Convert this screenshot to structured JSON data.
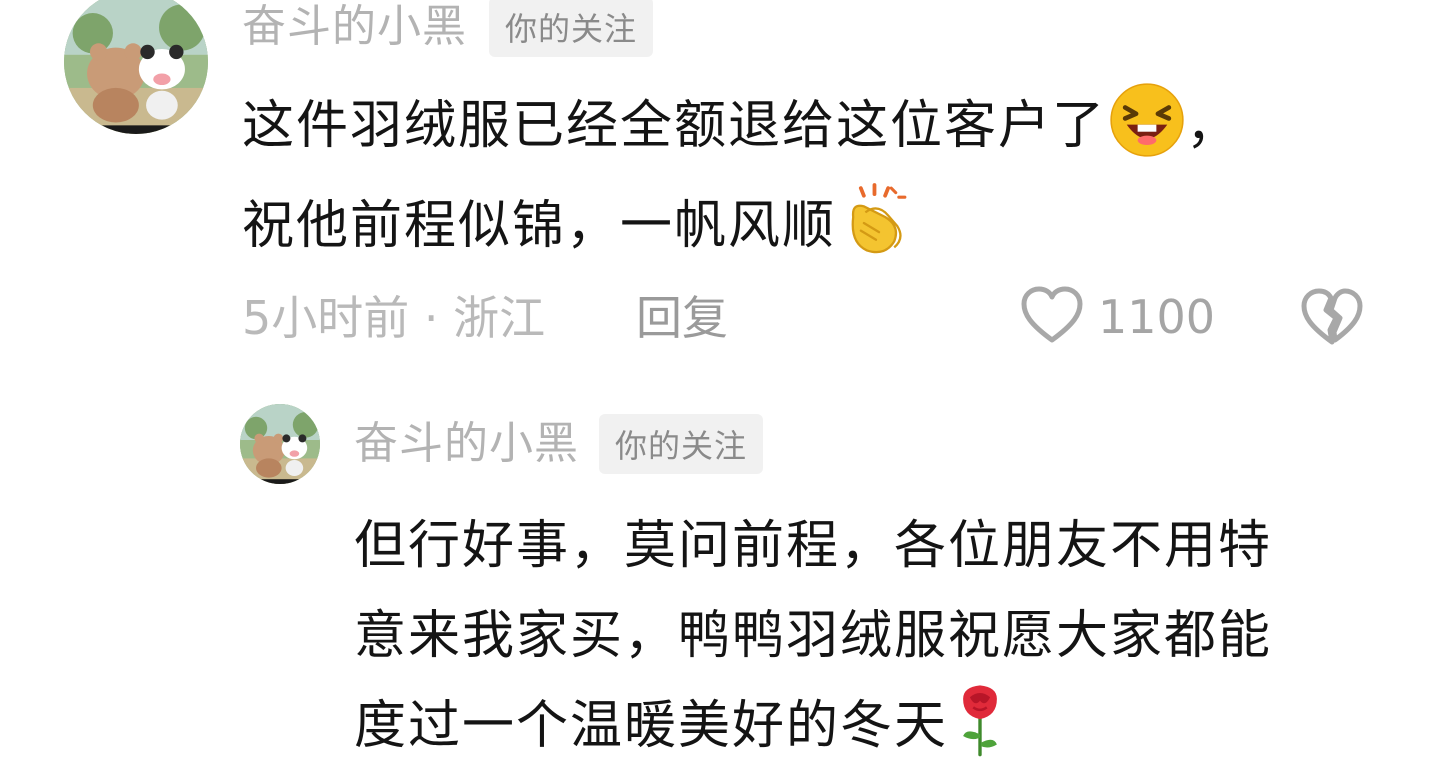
{
  "comment": {
    "username": "奋斗的小黑",
    "badge": "你的关注",
    "lines": [
      "这件羽绒服已经全额退给这位客户了",
      "，",
      "祝他前程似锦，一帆风顺"
    ],
    "time": "5小时前 · 浙江",
    "reply_label": "回复",
    "like_count": "1100",
    "emojis": [
      "laughing-face-emoji",
      "clapping-hands-emoji"
    ]
  },
  "reply": {
    "username": "奋斗的小黑",
    "badge": "你的关注",
    "lines": [
      "但行好事，莫问前程，各位朋友不用特",
      "意来我家买，鸭鸭羽绒服祝愿大家都能",
      "度过一个温暖美好的冬天"
    ],
    "emojis": [
      "rose-emoji"
    ]
  },
  "colors": {
    "text": "#141414",
    "username": "#b3b3b3",
    "badge_bg": "#f1f1f1",
    "badge_text": "#8a8a8a",
    "meta": "#b9b9b9"
  },
  "icons": [
    "heart-outline-icon",
    "broken-heart-icon"
  ]
}
